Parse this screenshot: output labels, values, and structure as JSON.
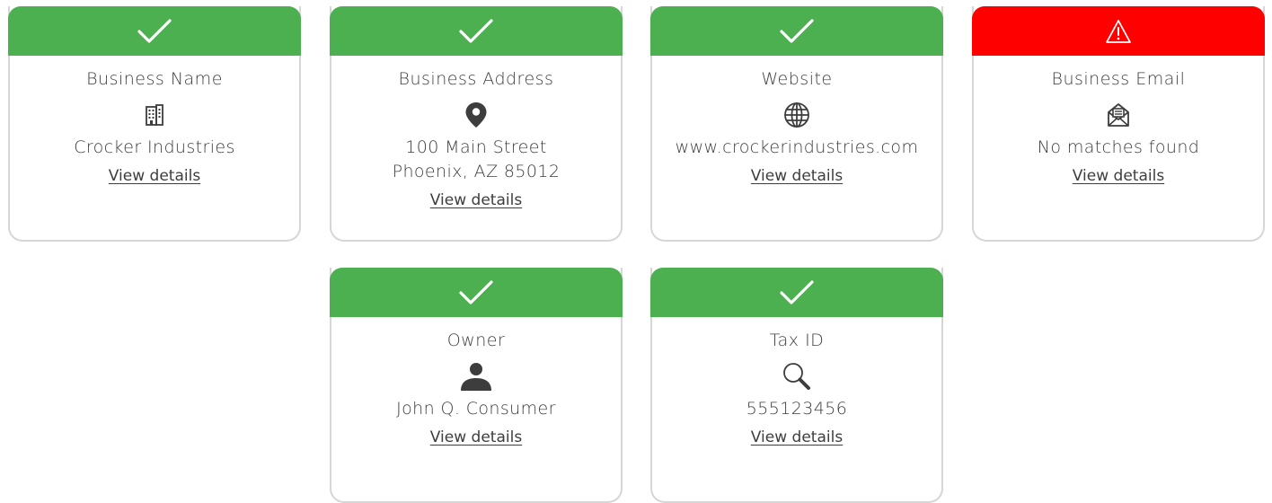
{
  "colors": {
    "success": "#4caf50",
    "error": "#ff0000",
    "text": "#3d3d3d",
    "border": "#d6d6d6"
  },
  "cards": [
    {
      "status": "success",
      "status_icon": "check-icon",
      "label": "Business Name",
      "icon": "building-icon",
      "value_lines": [
        "Crocker Industries"
      ],
      "link": "View details"
    },
    {
      "status": "success",
      "status_icon": "check-icon",
      "label": "Business Address",
      "icon": "map-pin-icon",
      "value_lines": [
        "100 Main Street",
        "Phoenix, AZ 85012"
      ],
      "link": "View details"
    },
    {
      "status": "success",
      "status_icon": "check-icon",
      "label": "Website",
      "icon": "globe-icon",
      "value_lines": [
        "www.crockerindustries.com"
      ],
      "link": "View details"
    },
    {
      "status": "error",
      "status_icon": "warning-icon",
      "label": "Business Email",
      "icon": "envelope-icon",
      "value_lines": [
        "No matches found"
      ],
      "link": "View details"
    },
    {
      "status": "success",
      "status_icon": "check-icon",
      "label": "Owner",
      "icon": "person-icon",
      "value_lines": [
        "John Q. Consumer"
      ],
      "link": "View details"
    },
    {
      "status": "success",
      "status_icon": "check-icon",
      "label": "Tax ID",
      "icon": "magnifier-icon",
      "value_lines": [
        "555123456"
      ],
      "link": "View details"
    }
  ]
}
